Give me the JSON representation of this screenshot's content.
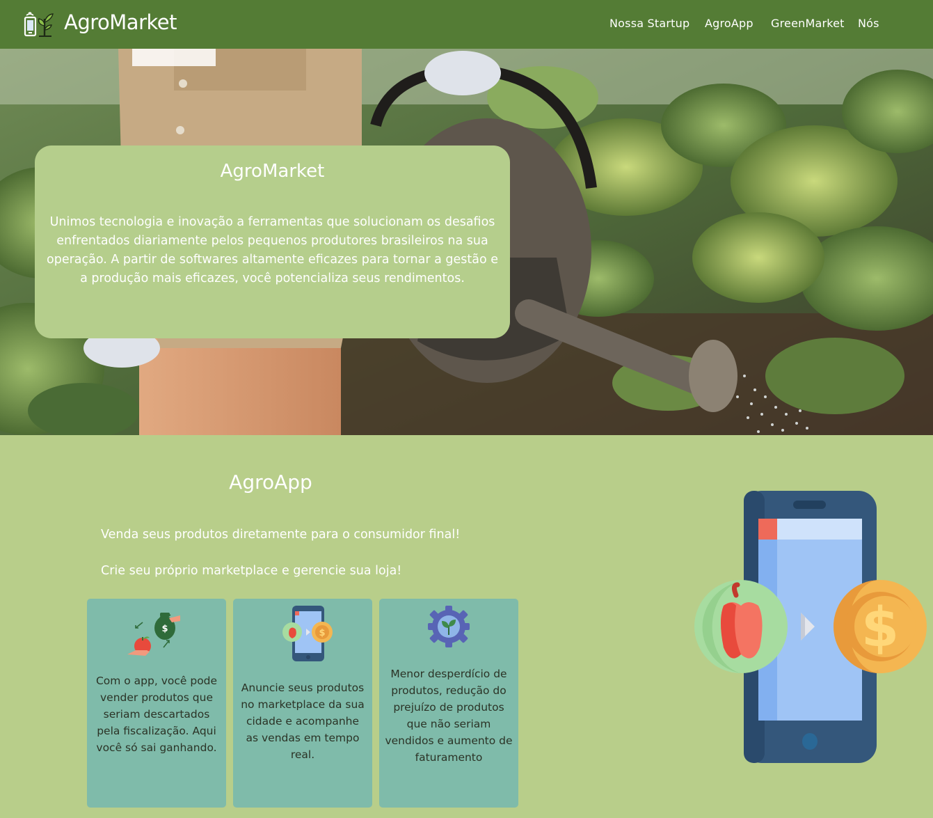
{
  "navbar": {
    "brand": "AgroMarket",
    "links": [
      "Nossa Startup",
      "AgroApp",
      "GreenMarket",
      "Nós"
    ],
    "bg_color": "#547c35"
  },
  "hero": {
    "title": "AgroMarket",
    "text": "Unimos tecnologia e inovação a ferramentas que solucionam os desafios enfrentados diariamente pelos pequenos produtores brasileiros na sua operação. A partir de softwares altamente eficazes para tornar a gestão e a produção mais eficazes, você potencializa seus rendimentos.",
    "card_color": "#b5ce8c"
  },
  "agroapp": {
    "title": "AgroApp",
    "line1": "Venda seus produtos diretamente para o consumidor final!",
    "line2": "Crie seu próprio marketplace e gerencie sua loja!",
    "section_color": "#b8ce8a",
    "cards": [
      {
        "icon": "money-exchange-icon",
        "text": "Com o app, você pode vender produtos que seriam descartados pela fiscalização. Aqui você só sai ganhando."
      },
      {
        "icon": "phone-sale-icon",
        "text": "Anuncie seus produtos no marketplace da sua cidade e acompanhe as vendas em tempo real."
      },
      {
        "icon": "gear-plant-icon",
        "text": "Menor desperdício de produtos, redução do prejuízo de produtos que não seriam vendidos e aumento de faturamento"
      }
    ],
    "card_color": "#7fbbaa"
  }
}
